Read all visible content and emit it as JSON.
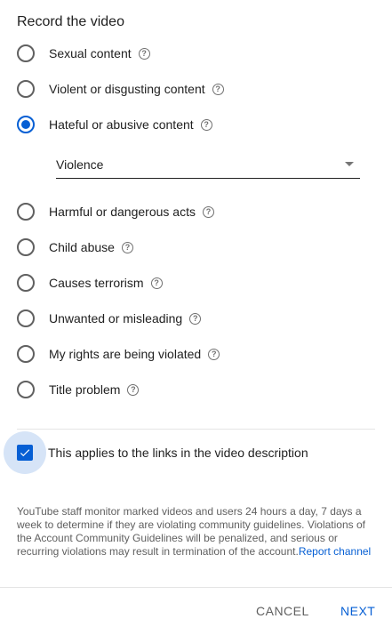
{
  "dialog": {
    "title": "Record the video",
    "reasons": [
      {
        "label": "Sexual content",
        "checked": false
      },
      {
        "label": "Violent or disgusting content",
        "checked": false
      },
      {
        "label": "Hateful or abusive content",
        "checked": true
      },
      {
        "label": "Harmful or dangerous acts",
        "checked": false
      },
      {
        "label": "Child abuse",
        "checked": false
      },
      {
        "label": "Causes terrorism",
        "checked": false
      },
      {
        "label": "Unwanted or misleading",
        "checked": false
      },
      {
        "label": "My rights are being violated",
        "checked": false
      },
      {
        "label": "Title problem",
        "checked": false
      }
    ],
    "help_glyph": "?",
    "subreason": {
      "selected": "Violence"
    },
    "links_checkbox": {
      "label": "This applies to the links in the video description",
      "checked": true
    },
    "notice": {
      "text": "YouTube staff monitor marked videos and users 24 hours a day, 7 days a week to determine if they are violating community guidelines. Violations of the Account Community Guidelines will be penalized, and serious or recurring violations may result in termination of the account.",
      "link_text": "Report channel"
    },
    "buttons": {
      "cancel": "CANCEL",
      "next": "NEXT"
    }
  },
  "colors": {
    "accent": "#065fd4",
    "checkbox_halo": "#d6e4f7",
    "secondary_text": "#606060"
  },
  "icons": {
    "radio": "radio-button-icon",
    "help": "help-circle-icon",
    "dropdown": "triangle-down-icon",
    "check": "checkmark-icon"
  }
}
